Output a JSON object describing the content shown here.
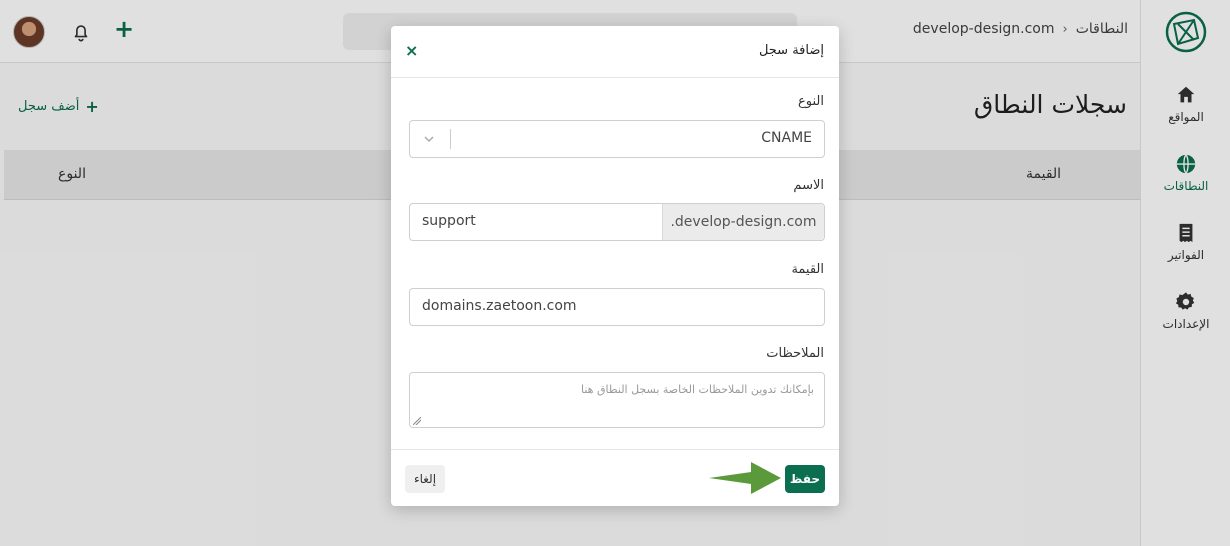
{
  "topbar": {
    "breadcrumb_root": "النطاقات",
    "breadcrumb_current": "develop-design.com",
    "breadcrumb_separator": "‹"
  },
  "sidebar": {
    "items": [
      {
        "label": "المواقع",
        "icon": "home-icon"
      },
      {
        "label": "النطاقات",
        "icon": "globe-icon",
        "active": true
      },
      {
        "label": "الفواتير",
        "icon": "receipt-icon"
      },
      {
        "label": "الإعدادات",
        "icon": "gear-icon"
      }
    ]
  },
  "page": {
    "title": "سجلات النطاق",
    "add_record": "أضف سجل",
    "columns": [
      "القيمة",
      "النوع"
    ]
  },
  "modal": {
    "title": "إضافة سجل",
    "close": "×",
    "type_label": "النوع",
    "type_value": "CNAME",
    "name_label": "الاسم",
    "name_value": "support",
    "name_suffix": ".develop-design.com",
    "value_label": "القيمة",
    "value_value": "domains.zaetoon.com",
    "notes_label": "الملاحظات",
    "notes_placeholder": "بإمكانك تدوين الملاحظات الخاصة بسجل النطاق هنا",
    "save_label": "حفظ",
    "cancel_label": "إلغاء"
  },
  "colors": {
    "accent": "#0b6e4f",
    "arrow": "#5a9a3a"
  }
}
